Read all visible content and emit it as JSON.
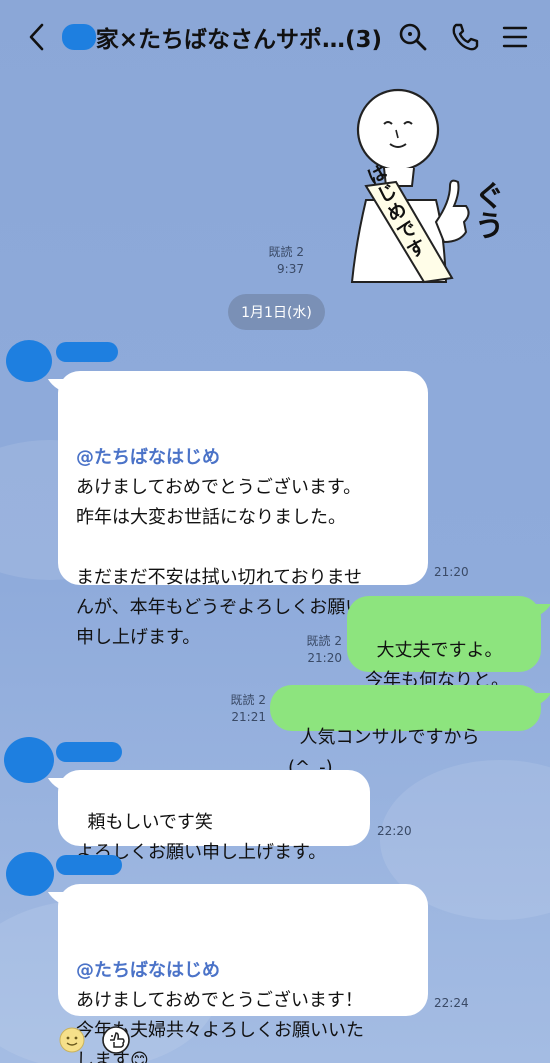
{
  "header": {
    "title": "家×たちばなさんサポ…(3)",
    "icons": [
      "chevron-left-icon",
      "search-icon",
      "phone-icon",
      "menu-icon"
    ]
  },
  "sticker": {
    "sash_text": "はじめです",
    "side_text": "ぐう",
    "read": "既読 2",
    "time": "9:37"
  },
  "date_divider": "1月1日(水)",
  "messages": [
    {
      "mention": "@たちばなはじめ",
      "text": "あけましておめでとうございます。\n昨年は大変お世話になりました。\n\nまだまだ不安は拭い切れておりませ\nんが、本年もどうぞよろしくお願い\n申し上げます。",
      "time": "21:20"
    },
    {
      "text": "大丈夫ですよ。\n今年も何なりと。",
      "read": "既読 2",
      "time": "21:20"
    },
    {
      "text": "人気コンサルですから(^_-)",
      "read": "既読 2",
      "time": "21:21"
    },
    {
      "text": "頼もしいです笑\nよろしくお願い申し上げます。",
      "time": "22:20"
    },
    {
      "mention": "@たちばなはじめ",
      "text": "あけましておめでとうございます！\n今年も夫婦共々よろしくお願いいた\nします😊",
      "time": "22:24"
    }
  ],
  "reactions": [
    "smile-reaction-icon",
    "thumbs-up-reaction-icon"
  ],
  "colors": {
    "background": "#8aa8d8",
    "incoming_bubble": "#ffffff",
    "outgoing_bubble": "#8de47e",
    "mention": "#4b73c8",
    "redaction": "#1e7fe0"
  }
}
